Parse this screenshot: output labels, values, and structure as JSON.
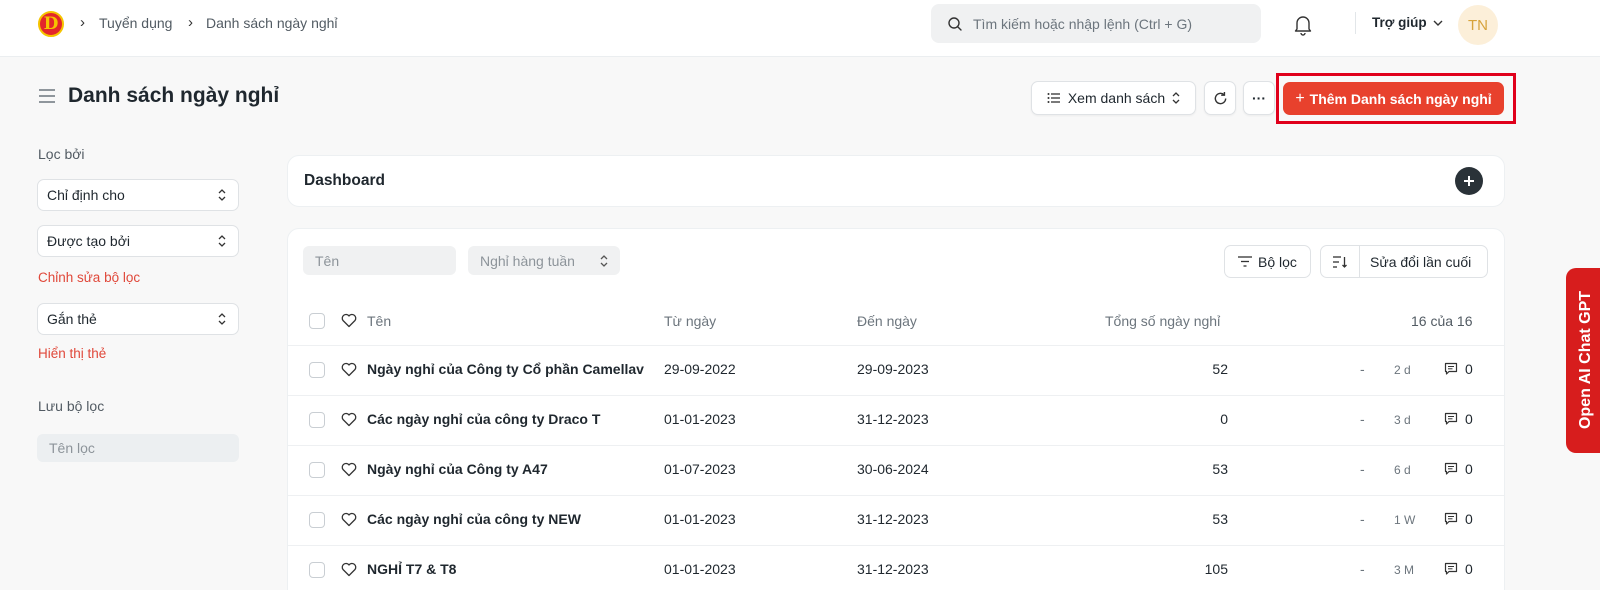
{
  "navbar": {
    "logo_letter": "D",
    "breadcrumbs": [
      "Tuyển dụng",
      "Danh sách ngày nghỉ"
    ],
    "search_placeholder": "Tìm kiếm hoặc nhập lệnh (Ctrl + G)",
    "help_label": "Trợ giúp",
    "avatar_initials": "TN"
  },
  "page": {
    "title": "Danh sách ngày nghỉ",
    "view_label": "Xem danh sách",
    "more_label": "···",
    "primary_label": "Thêm Danh sách ngày nghỉ"
  },
  "sidebar": {
    "filter_heading": "Lọc bởi",
    "assigned_to": "Chỉ định cho",
    "created_by": "Được tạo bởi",
    "edit_filters": "Chỉnh sửa bộ lọc",
    "tags": "Gắn thẻ",
    "show_tags": "Hiển thị thẻ",
    "saved_filters_heading": "Lưu bộ lọc",
    "filter_name_placeholder": "Tên lọc"
  },
  "dashboard": {
    "title": "Dashboard"
  },
  "list": {
    "name_filter_placeholder": "Tên",
    "weekly_off_placeholder": "Nghỉ hàng tuần",
    "filter_label": "Bộ lọc",
    "sort_label": "Sửa đổi lần cuối",
    "columns": [
      "Tên",
      "Từ ngày",
      "Đến ngày",
      "Tổng số ngày nghỉ"
    ],
    "count_label": "16 của 16",
    "rows": [
      {
        "name": "Ngày nghỉ của Công ty Cổ phần Camellav",
        "from": "29-09-2022",
        "to": "29-09-2023",
        "total": "52",
        "dash": "-",
        "age": "2 d",
        "comments": "0"
      },
      {
        "name": "Các ngày nghỉ của công ty Draco T",
        "from": "01-01-2023",
        "to": "31-12-2023",
        "total": "0",
        "dash": "-",
        "age": "3 d",
        "comments": "0"
      },
      {
        "name": "Ngày nghỉ của Công ty A47",
        "from": "01-07-2023",
        "to": "30-06-2024",
        "total": "53",
        "dash": "-",
        "age": "6 d",
        "comments": "0"
      },
      {
        "name": "Các ngày nghỉ của công ty NEW",
        "from": "01-01-2023",
        "to": "31-12-2023",
        "total": "53",
        "dash": "-",
        "age": "1 W",
        "comments": "0"
      },
      {
        "name": "NGHỈ T7 & T8",
        "from": "01-01-2023",
        "to": "31-12-2023",
        "total": "105",
        "dash": "-",
        "age": "3 M",
        "comments": "0"
      }
    ]
  },
  "side_tab": {
    "label": "Open AI Chat GPT"
  },
  "colors": {
    "primary": "#e8412d",
    "highlight": "#e0001b",
    "tab": "#d71d1d"
  }
}
